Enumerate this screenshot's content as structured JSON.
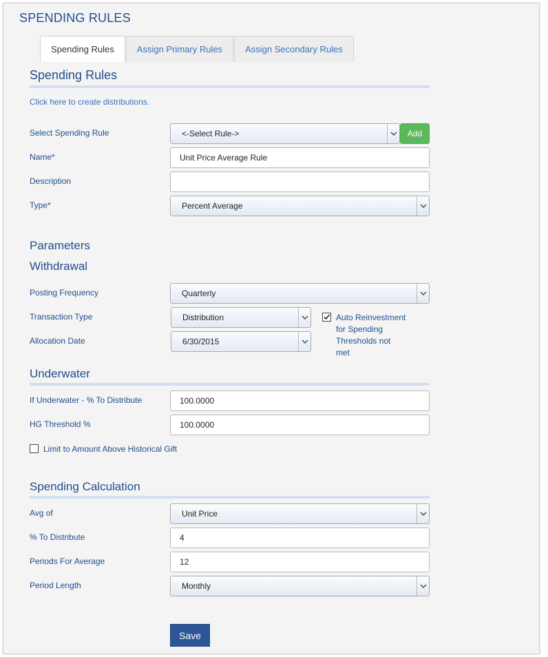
{
  "page": {
    "title": "SPENDING RULES"
  },
  "tabs": [
    {
      "label": "Spending Rules",
      "active": true
    },
    {
      "label": "Assign Primary Rules",
      "active": false
    },
    {
      "label": "Assign Secondary Rules",
      "active": false
    }
  ],
  "rules": {
    "heading": "Spending Rules",
    "create_link": "Click here to create distributions.",
    "select_label": "Select Spending Rule",
    "select_value": "<-Select Rule->",
    "add_label": "Add",
    "name_label": "Name*",
    "name_value": "Unit Price Average Rule",
    "description_label": "Description",
    "description_value": "",
    "type_label": "Type*",
    "type_value": "Percent Average"
  },
  "parameters": {
    "heading": "Parameters",
    "withdrawal_heading": "Withdrawal",
    "posting_frequency_label": "Posting Frequency",
    "posting_frequency_value": "Quarterly",
    "transaction_type_label": "Transaction Type",
    "transaction_type_value": "Distribution",
    "allocation_date_label": "Allocation Date",
    "allocation_date_value": "6/30/2015",
    "auto_reinvest_checked": true,
    "auto_reinvest_lines": [
      "Auto Reinvestment",
      "for Spending",
      "Thresholds not",
      "met"
    ]
  },
  "underwater": {
    "heading": "Underwater",
    "pct_label": "If Underwater - % To Distribute",
    "pct_value": "100.0000",
    "hg_label": "HG Threshold %",
    "hg_value": "100.0000",
    "limit_label": "Limit to Amount Above Historical Gift",
    "limit_checked": false
  },
  "calculation": {
    "heading": "Spending Calculation",
    "avg_of_label": "Avg of",
    "avg_of_value": "Unit Price",
    "pct_label": "% To Distribute",
    "pct_value": "4",
    "periods_label": "Periods For Average",
    "periods_value": "12",
    "period_length_label": "Period Length",
    "period_length_value": "Monthly"
  },
  "save_label": "Save",
  "icons": {
    "dropdown": "chevron-down-icon",
    "check": "check-icon"
  },
  "colors": {
    "heading": "#1f4e8c",
    "link": "#3b73b9",
    "add_button": "#5cb85c",
    "save_button": "#2c5696"
  }
}
